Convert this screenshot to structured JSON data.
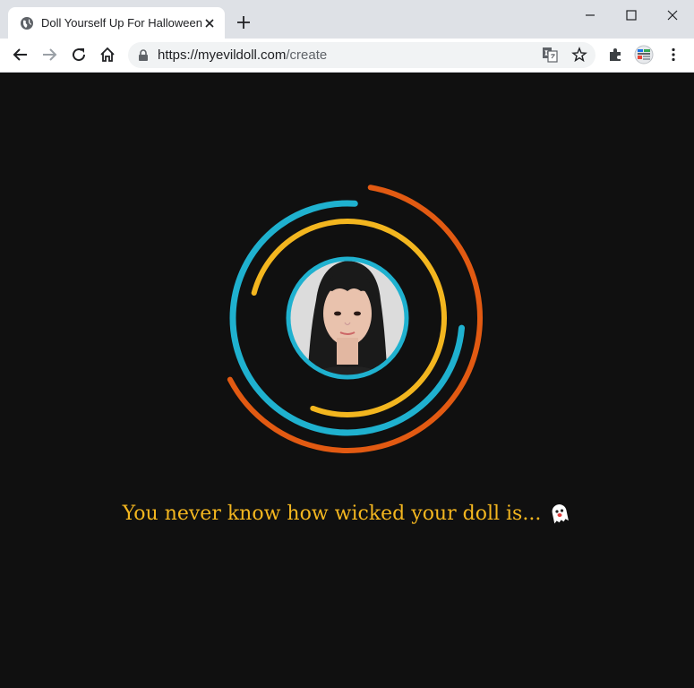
{
  "browser": {
    "tab": {
      "title": "Doll Yourself Up For Halloween",
      "favicon": "globe-icon"
    },
    "new_tab_icon": "plus-icon",
    "address": {
      "scheme_host": "https://myevildoll.com",
      "path": "/create"
    },
    "icons": [
      "back-icon",
      "forward-icon",
      "reload-icon",
      "home-icon",
      "lock-icon",
      "translate-icon",
      "star-icon",
      "extensions-icon",
      "profile-icon",
      "menu-icon"
    ]
  },
  "page": {
    "tagline": "You never know how wicked your doll is...",
    "tagline_emoji": "ghost-icon",
    "colors": {
      "background": "#101010",
      "ring_orange": "#e25a12",
      "ring_blue": "#1fb1cf",
      "ring_yellow": "#f3b61f",
      "avatar_border": "#1fb1cf",
      "text": "#f3b61f"
    }
  }
}
